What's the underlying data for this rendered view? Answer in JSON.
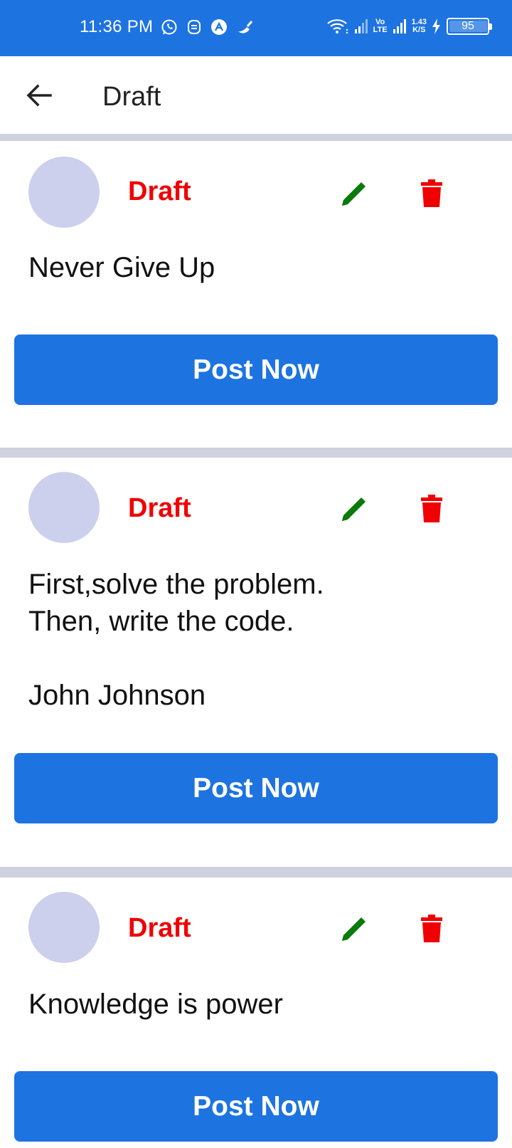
{
  "status_bar": {
    "time": "11:36 PM",
    "left_icons": [
      "whatsapp-icon",
      "notification-app-icon",
      "app-icon",
      "cleaner-icon"
    ],
    "network_speed_value": "1.43",
    "network_speed_unit": "K/S",
    "volte_top": "Vo",
    "volte_bottom": "LTE",
    "battery_level": "95"
  },
  "app_bar": {
    "title": "Draft",
    "back_icon": "arrow-left-icon"
  },
  "colors": {
    "accent": "#1d73e0",
    "status_red": "#f00000",
    "edit_green": "#0a7a0a",
    "avatar": "#ccd0ec",
    "divider": "#cfd1df"
  },
  "drafts": [
    {
      "status": "Draft",
      "text": "Never Give Up",
      "action": "Post Now"
    },
    {
      "status": "Draft",
      "text": "First,solve the problem.\nThen, write the code.\n\nJohn Johnson",
      "action": "Post Now"
    },
    {
      "status": "Draft",
      "text": "Knowledge is power",
      "action": "Post Now"
    }
  ]
}
